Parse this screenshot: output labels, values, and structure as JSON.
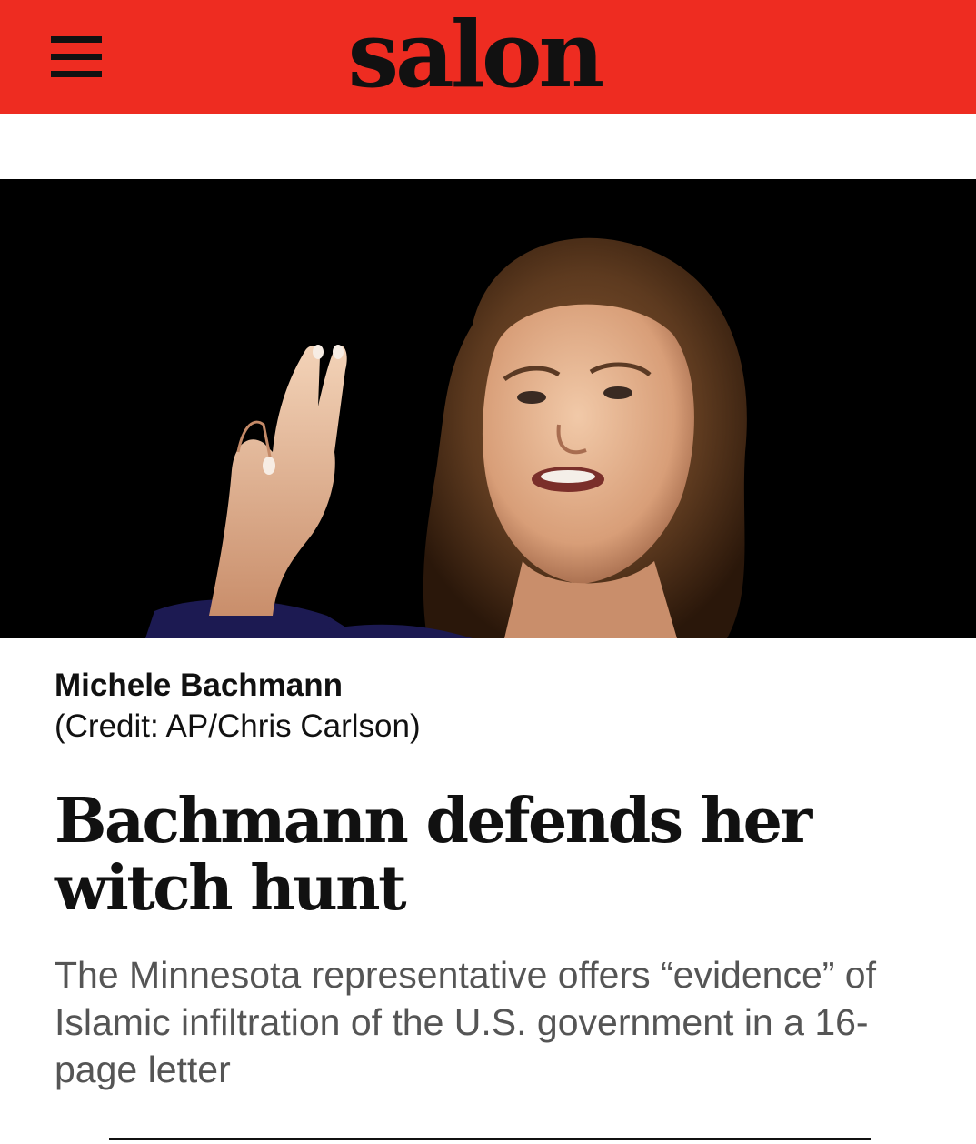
{
  "header": {
    "logo": "salon",
    "menu_icon": "hamburger-menu-icon",
    "background_color": "#ee2c21"
  },
  "article": {
    "image": {
      "subject": "photo"
    },
    "caption": {
      "name": "Michele Bachmann",
      "credit": "(Credit: AP/Chris Carlson)"
    },
    "headline": "Bachmann defends her witch hunt",
    "dek": "The Minnesota representative offers “evidence” of Islamic infiltration of the U.S. government in a 16-page letter"
  }
}
